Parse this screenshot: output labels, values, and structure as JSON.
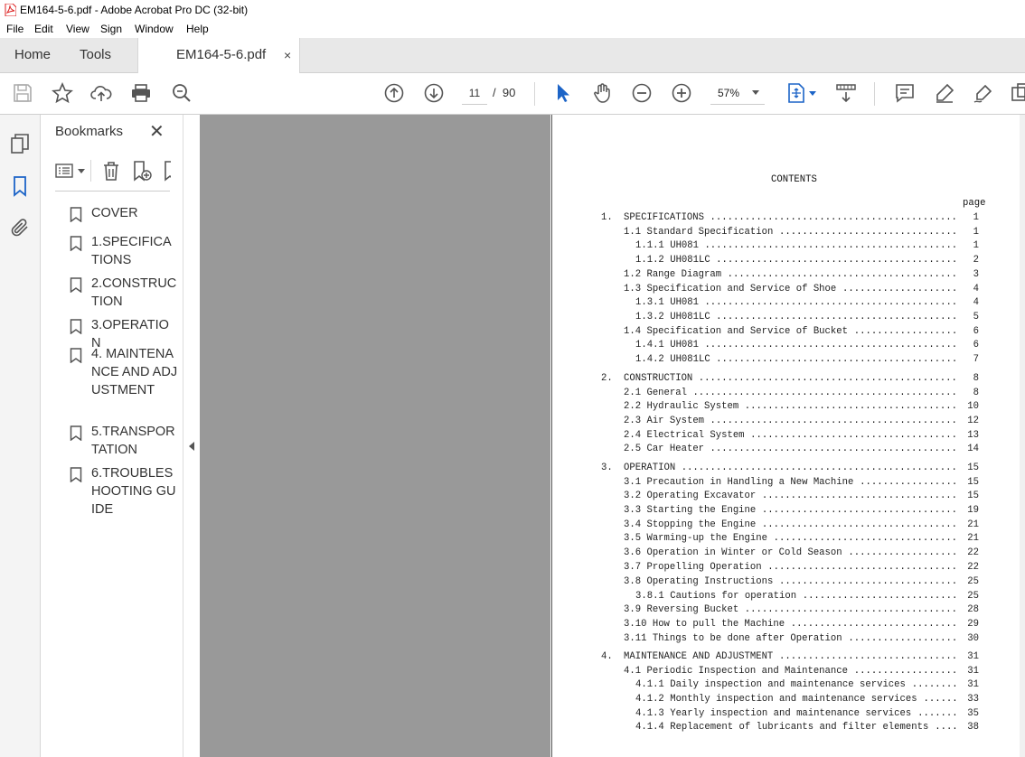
{
  "window": {
    "title": "EM164-5-6.pdf - Adobe Acrobat Pro DC (32-bit)"
  },
  "menu": [
    "File",
    "Edit",
    "View",
    "Sign",
    "Window",
    "Help"
  ],
  "tabs": {
    "home": "Home",
    "tools": "Tools",
    "doc": "EM164-5-6.pdf",
    "close": "×"
  },
  "toolbar": {
    "page_current": "11",
    "page_sep": "/",
    "page_total": "90",
    "zoom": "57%"
  },
  "bookmarks": {
    "title": "Bookmarks",
    "items": [
      {
        "label": "COVER"
      },
      {
        "label": "1.SPECIFICATIONS"
      },
      {
        "label": "2.CONSTRUCTION"
      },
      {
        "label": "3.OPERATION"
      },
      {
        "label": "4. MAINTENANCE AND ADJUSTMENT"
      },
      {
        "label": "5.TRANSPORTATION"
      },
      {
        "label": "6.TROUBLESHOOTING GUIDE"
      }
    ]
  },
  "document": {
    "heading": "CONTENTS",
    "page_col": "page",
    "entries": [
      {
        "num": "1.",
        "title": "SPECIFICATIONS",
        "page": "1",
        "level": 0
      },
      {
        "num": "1.1",
        "title": "Standard Specification",
        "page": "1",
        "level": 1
      },
      {
        "num": "1.1.1",
        "title": "UH081",
        "page": "1",
        "level": 2
      },
      {
        "num": "1.1.2",
        "title": "UH081LC",
        "page": "2",
        "level": 2
      },
      {
        "num": "1.2",
        "title": "Range Diagram",
        "page": "3",
        "level": 1
      },
      {
        "num": "1.3",
        "title": "Specification and Service of Shoe",
        "page": "4",
        "level": 1
      },
      {
        "num": "1.3.1",
        "title": "UH081",
        "page": "4",
        "level": 2
      },
      {
        "num": "1.3.2",
        "title": "UH081LC",
        "page": "5",
        "level": 2
      },
      {
        "num": "1.4",
        "title": "Specification and Service of Bucket",
        "page": "6",
        "level": 1
      },
      {
        "num": "1.4.1",
        "title": "UH081",
        "page": "6",
        "level": 2
      },
      {
        "num": "1.4.2",
        "title": "UH081LC",
        "page": "7",
        "level": 2
      },
      {
        "num": "2.",
        "title": "CONSTRUCTION",
        "page": "8",
        "level": 0
      },
      {
        "num": "2.1",
        "title": "General",
        "page": "8",
        "level": 1
      },
      {
        "num": "2.2",
        "title": "Hydraulic System",
        "page": "10",
        "level": 1
      },
      {
        "num": "2.3",
        "title": "Air System",
        "page": "12",
        "level": 1
      },
      {
        "num": "2.4",
        "title": "Electrical System",
        "page": "13",
        "level": 1
      },
      {
        "num": "2.5",
        "title": "Car Heater",
        "page": "14",
        "level": 1
      },
      {
        "num": "3.",
        "title": "OPERATION",
        "page": "15",
        "level": 0
      },
      {
        "num": "3.1",
        "title": "Precaution in Handling a New Machine",
        "page": "15",
        "level": 1
      },
      {
        "num": "3.2",
        "title": "Operating Excavator",
        "page": "15",
        "level": 1
      },
      {
        "num": "3.3",
        "title": "Starting the Engine",
        "page": "19",
        "level": 1
      },
      {
        "num": "3.4",
        "title": "Stopping the Engine",
        "page": "21",
        "level": 1
      },
      {
        "num": "3.5",
        "title": "Warming-up the Engine",
        "page": "21",
        "level": 1
      },
      {
        "num": "3.6",
        "title": "Operation in Winter or Cold Season",
        "page": "22",
        "level": 1
      },
      {
        "num": "3.7",
        "title": "Propelling Operation",
        "page": "22",
        "level": 1
      },
      {
        "num": "3.8",
        "title": "Operating Instructions",
        "page": "25",
        "level": 1
      },
      {
        "num": "3.8.1",
        "title": "Cautions for operation",
        "page": "25",
        "level": 2
      },
      {
        "num": "3.9",
        "title": "Reversing Bucket",
        "page": "28",
        "level": 1
      },
      {
        "num": "3.10",
        "title": "How to pull the Machine",
        "page": "29",
        "level": 1
      },
      {
        "num": "3.11",
        "title": "Things to be done after Operation",
        "page": "30",
        "level": 1
      },
      {
        "num": "4.",
        "title": "MAINTENANCE AND ADJUSTMENT",
        "page": "31",
        "level": 0
      },
      {
        "num": "4.1",
        "title": "Periodic Inspection and Maintenance",
        "page": "31",
        "level": 1
      },
      {
        "num": "4.1.1",
        "title": "Daily inspection and maintenance services",
        "page": "31",
        "level": 2
      },
      {
        "num": "4.1.2",
        "title": "Monthly inspection and maintenance services",
        "page": "33",
        "level": 2
      },
      {
        "num": "4.1.3",
        "title": "Yearly inspection and maintenance services",
        "page": "35",
        "level": 2
      },
      {
        "num": "4.1.4",
        "title": "Replacement of lubricants and filter elements",
        "page": "38",
        "level": 2
      }
    ]
  }
}
